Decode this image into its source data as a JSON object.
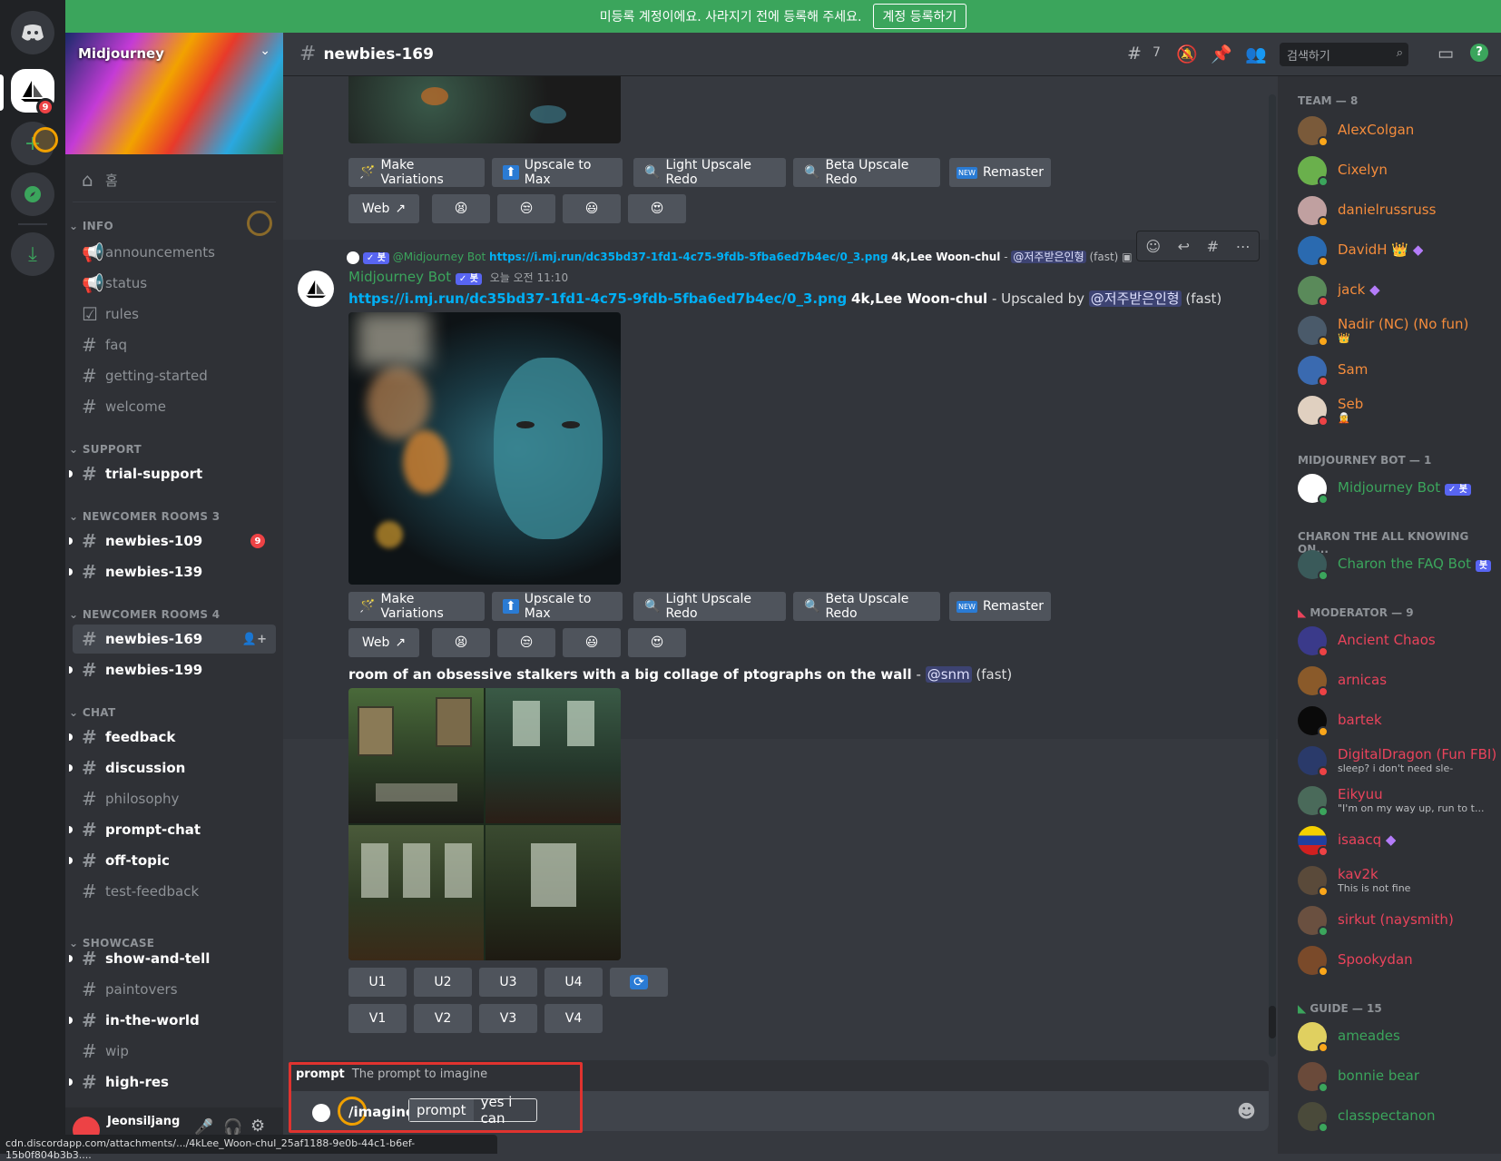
{
  "banner": {
    "text": "미등록 계정이에요. 사라지기 전에 등록해 주세요.",
    "button": "계정 등록하기"
  },
  "guilds": {
    "mention_badge": "9"
  },
  "server": {
    "name": "Midjourney"
  },
  "sidebar": {
    "home": "홈",
    "categories": {
      "info": "INFO",
      "support": "SUPPORT",
      "newcomer3": "NEWCOMER ROOMS 3",
      "newcomer4": "NEWCOMER ROOMS 4",
      "chat": "CHAT",
      "showcase": "SHOWCASE"
    },
    "channels": {
      "announcements": "announcements",
      "status": "status",
      "rules": "rules",
      "faq": "faq",
      "getting_started": "getting-started",
      "welcome": "welcome",
      "trial_support": "trial-support",
      "newbies_109": "newbies-109",
      "newbies_109_badge": "9",
      "newbies_139": "newbies-139",
      "newbies_169": "newbies-169",
      "newbies_199": "newbies-199",
      "feedback": "feedback",
      "discussion": "discussion",
      "philosophy": "philosophy",
      "prompt_chat": "prompt-chat",
      "off_topic": "off-topic",
      "test_feedback": "test-feedback",
      "show_and_tell": "show-and-tell",
      "paintovers": "paintovers",
      "in_the_world": "in-the-world",
      "wip": "wip",
      "high_res": "high-res"
    },
    "user": "Jeonsiljang"
  },
  "topbar": {
    "channel": "newbies-169",
    "threads_count": "7",
    "search_placeholder": "검색하기"
  },
  "buttons": {
    "make_variations": "Make Variations",
    "upscale_to_max": "Upscale to Max",
    "light_upscale_redo": "Light Upscale Redo",
    "beta_upscale_redo": "Beta Upscale Redo",
    "remaster": "Remaster",
    "web": "Web",
    "u1": "U1",
    "u2": "U2",
    "u3": "U3",
    "u4": "U4",
    "v1": "V1",
    "v2": "V2",
    "v3": "V3",
    "v4": "V4",
    "new_tag": "NEW"
  },
  "message1": {
    "reply_author": "@Midjourney Bot",
    "reply_link": "https://i.mj.run/dc35bd37-1fd1-4c75-9fdb-5fba6ed7b4ec/0_3.png",
    "reply_prompt": "4k,Lee Woon-chul",
    "reply_mention": "@저주받은인형",
    "reply_speed": "(fast)",
    "author": "Midjourney Bot",
    "bot_tag": "✓ 봇",
    "timestamp": "오늘 오전 11:10",
    "link": "https://i.mj.run/dc35bd37-1fd1-4c75-9fdb-5fba6ed7b4ec/0_3.png",
    "prompt": "4k,Lee Woon-chul",
    "upscaled_by": "- Upscaled by",
    "mention": "@저주받은인형",
    "speed": "(fast)"
  },
  "message2": {
    "prompt": "room of an obsessive stalkers with a big collage of ptographs on the wall",
    "separator": "-",
    "mention": "@snm",
    "speed": "(fast)"
  },
  "composer": {
    "hint_label": "prompt",
    "hint_text": "The prompt to imagine",
    "command": "/imagine",
    "option": "prompt",
    "value": "yes i can"
  },
  "members": {
    "team_header": "TEAM — 8",
    "team": [
      "AlexColgan",
      "Cixelyn",
      "danielrussruss",
      "DavidH",
      "jack",
      "Nadir (NC) (No fun)",
      "Sam",
      "Seb"
    ],
    "bot_header": "MIDJOURNEY BOT — 1",
    "bot": "Midjourney Bot",
    "bot_tag": "✓ 봇",
    "charon_header": "CHARON THE ALL KNOWING ON...",
    "charon": "Charon the FAQ Bot",
    "charon_tag": "봇",
    "mod_header": "MODERATOR — 9",
    "mods": [
      "Ancient Chaos",
      "arnicas",
      "bartek",
      "DigitalDragon (Fun FBI)",
      "Eikyuu",
      "isaacq",
      "kav2k",
      "sirkut (naysmith)",
      "Spookydan"
    ],
    "mod_subs": {
      "digitaldragon": "sleep? i don't need sle-",
      "eikyuu": "\"I'm on my way up, run to t...",
      "kav2k": "This is not fine"
    },
    "guide_header": "GUIDE — 15",
    "guides": [
      "ameades",
      "bonnie bear",
      "classpectanon"
    ]
  },
  "statusbar": {
    "url": "cdn.discordapp.com/attachments/.../4kLee_Woon-chul_25af1188-9e0b-44c1-b6ef-15b0f804b3b3...."
  },
  "colors": {
    "team": "#f48c3c",
    "mod": "#e9435b",
    "bot": "#3ba55c",
    "guide": "#3ba55c"
  }
}
